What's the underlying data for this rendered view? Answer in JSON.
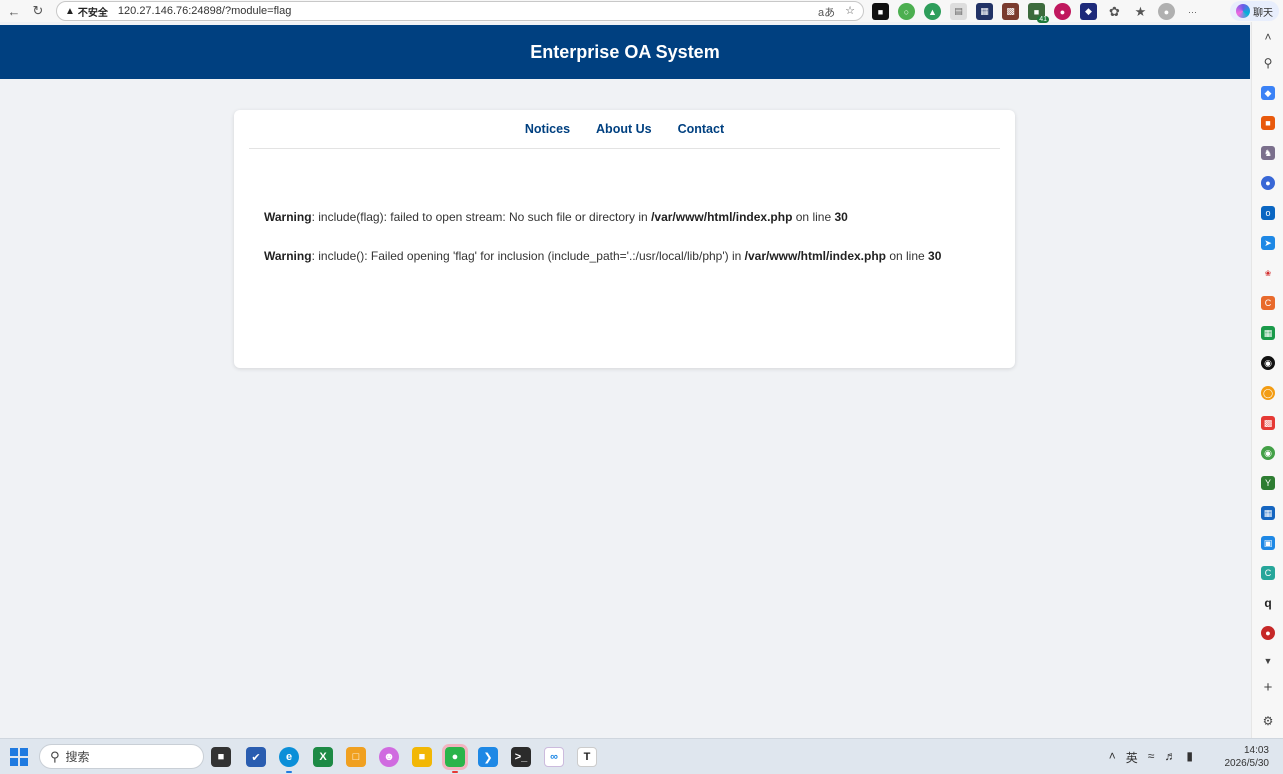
{
  "browser": {
    "security_label": "不安全",
    "url": "120.27.146.76:24898/?module=flag",
    "translate_glyph": "á",
    "more_glyph": "···",
    "chat_label": "聊天",
    "ext_badge": "41"
  },
  "header": {
    "title": "Enterprise OA System"
  },
  "nav": {
    "items": [
      "Notices",
      "About Us",
      "Contact"
    ]
  },
  "warnings": [
    {
      "label": "Warning",
      "message": ": include(flag): failed to open stream: No such file or directory in ",
      "file": "/var/www/html/index.php",
      "line_text": " on line ",
      "line": "30"
    },
    {
      "label": "Warning",
      "message": ": include(): Failed opening 'flag' for inclusion (include_path='.:/usr/local/lib/php') in ",
      "file": "/var/www/html/index.php",
      "line_text": " on line ",
      "line": "30"
    }
  ],
  "taskbar": {
    "search_placeholder": "搜索",
    "ime_label": "英",
    "time": "14:03",
    "date": "2026/5/30"
  },
  "colors": {
    "header_bg": "#004080",
    "nav_link": "#004080",
    "page_bg": "#f0f2f5"
  }
}
